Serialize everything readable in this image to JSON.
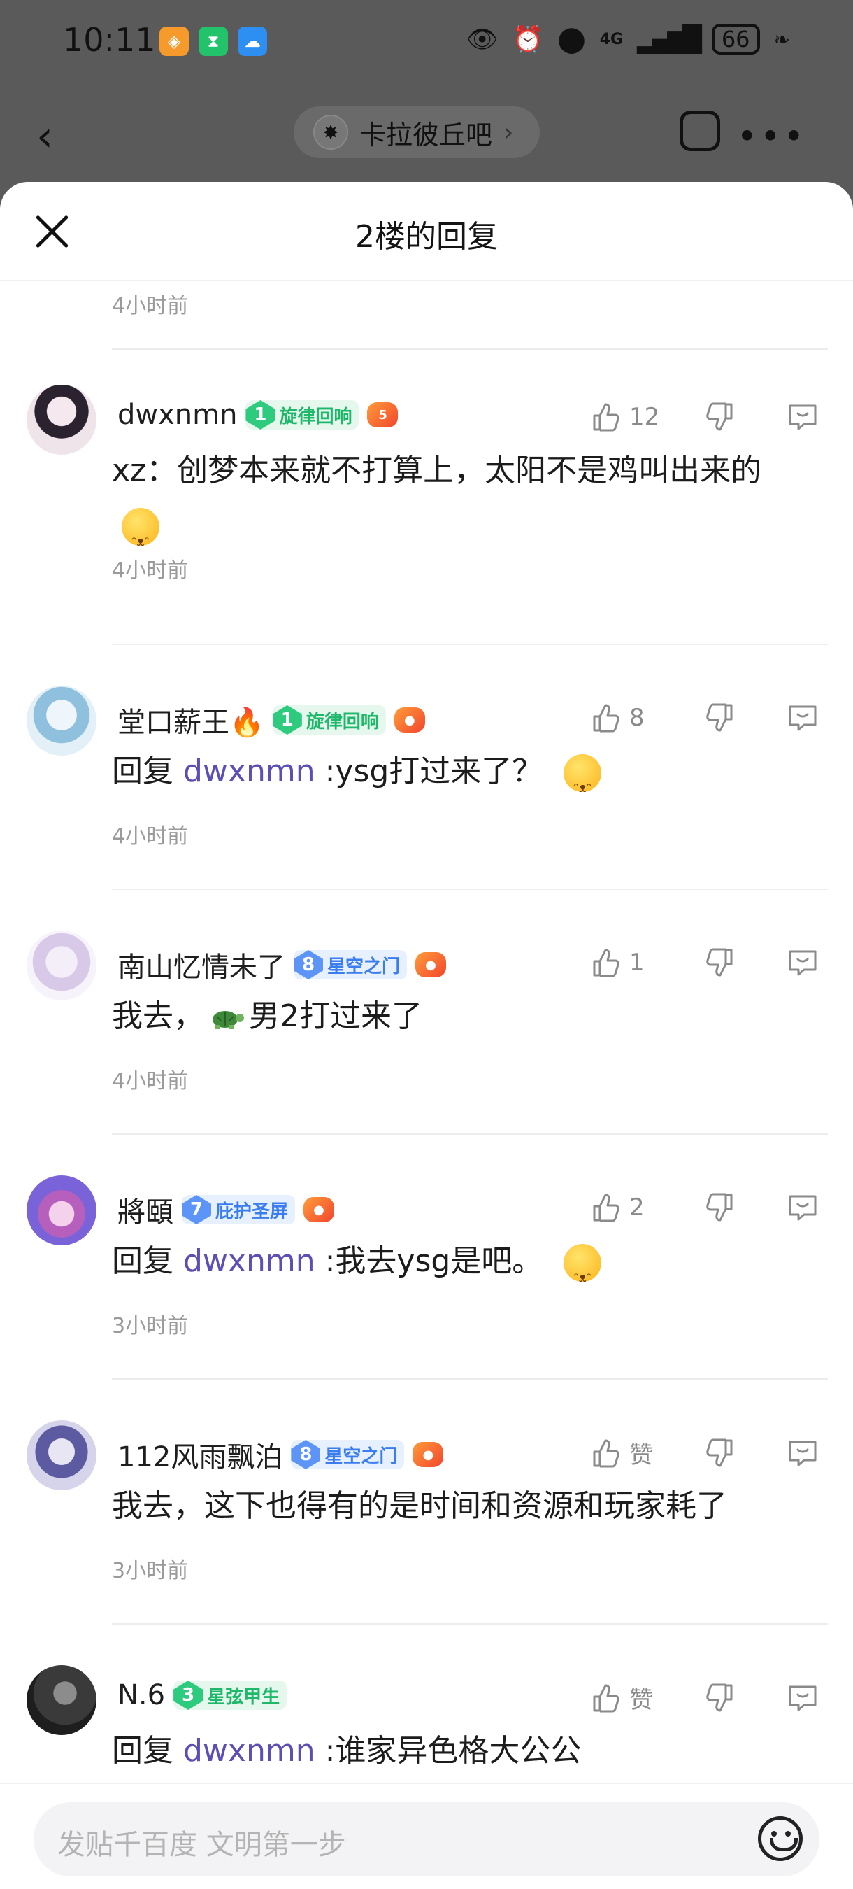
{
  "status_bar": {
    "time": "10:11",
    "network": "4G",
    "battery": "66",
    "icons": [
      "eye-icon",
      "alarm-icon",
      "location-icon",
      "signal-icon",
      "battery-icon",
      "leaf-icon"
    ]
  },
  "background_nav": {
    "forum_name": "卡拉彼丘吧",
    "chevron": "›"
  },
  "sheet": {
    "title": "2楼的回复",
    "top_timestamp": "4小时前"
  },
  "replies": [
    {
      "username": "dwxnmn",
      "level": "1",
      "badge": "旋律回响",
      "badge_color": "green",
      "likes": "12",
      "text": "xz：创梦本来就不打算上，太阳不是鸡叫出来的",
      "time": "4小时前"
    },
    {
      "username": "堂口薪王🔥",
      "level": "1",
      "badge": "旋律回响",
      "badge_color": "green",
      "likes": "8",
      "reply_prefix": "回复",
      "mention": "dwxnmn",
      "text": ":ysg打过来了？",
      "time": "4小时前"
    },
    {
      "username": "南山忆情未了",
      "level": "8",
      "badge": "星空之门",
      "badge_color": "blue",
      "likes": "1",
      "text_before": "我去，",
      "text_after": "男2打过来了",
      "time": "4小时前"
    },
    {
      "username": "將頤",
      "level": "7",
      "badge": "庇护圣屏",
      "badge_color": "blue",
      "likes": "2",
      "reply_prefix": "回复",
      "mention": "dwxnmn",
      "text": ":我去ysg是吧。",
      "time": "3小时前"
    },
    {
      "username": "112风雨飘泊",
      "level": "8",
      "badge": "星空之门",
      "badge_color": "blue",
      "likes": "赞",
      "text": "我去，这下也得有的是时间和资源和玩家耗了",
      "time": "3小时前"
    },
    {
      "username": "N.6",
      "level": "3",
      "badge": "星弦甲生",
      "badge_color": "green",
      "likes": "赞",
      "reply_prefix": "回复",
      "mention": "dwxnmn",
      "text": ":谁家异色格大公公"
    }
  ],
  "composer": {
    "placeholder": "发贴千百度 文明第一步"
  },
  "colors": {
    "accent_mention": "#5b4fb5",
    "level_green": "#2ecb7e",
    "level_blue": "#5c95f7",
    "muted": "#9a9a9a"
  }
}
